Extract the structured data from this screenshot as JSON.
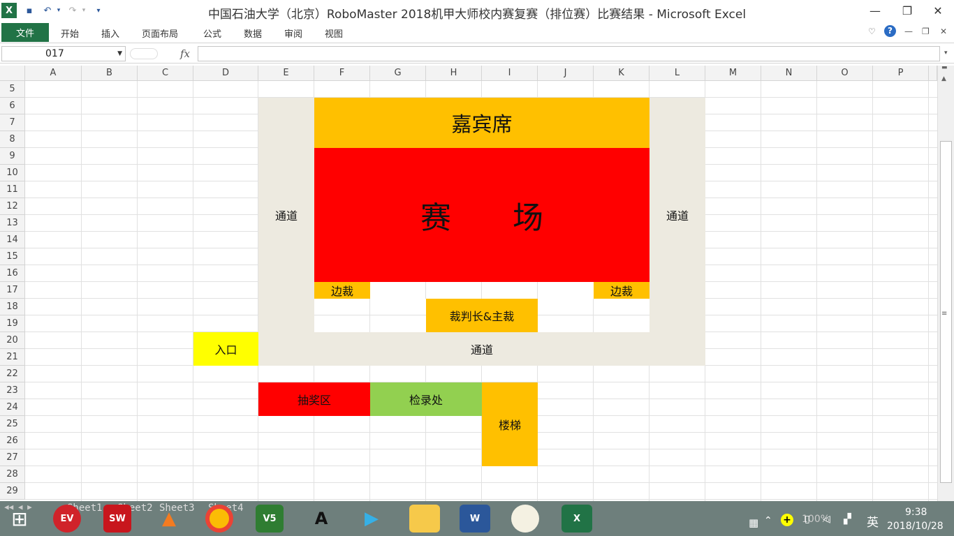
{
  "window": {
    "title": "中国石油大学（北京）RoboMaster 2018机甲大师校内赛复赛（排位赛）比赛结果 - Microsoft Excel"
  },
  "ribbon": {
    "file_tab": "文件",
    "tabs": [
      "开始",
      "插入",
      "页面布局",
      "公式",
      "数据",
      "审阅",
      "视图"
    ]
  },
  "formula_bar": {
    "name_box": "017",
    "fx_label": "fx",
    "formula": ""
  },
  "columns": [
    "A",
    "B",
    "C",
    "D",
    "E",
    "F",
    "G",
    "H",
    "I",
    "J",
    "K",
    "L",
    "M",
    "N",
    "O",
    "P"
  ],
  "rows": [
    "5",
    "6",
    "7",
    "8",
    "9",
    "10",
    "11",
    "12",
    "13",
    "14",
    "15",
    "16",
    "17",
    "18",
    "19",
    "20",
    "21",
    "22",
    "23",
    "24",
    "25",
    "26",
    "27",
    "28",
    "29"
  ],
  "layout_labels": {
    "guest_seats": "嘉宾席",
    "arena": "赛　　场",
    "aisle_left": "通道",
    "aisle_right": "通道",
    "aisle_bottom": "通道",
    "side_referee_left": "边裁",
    "side_referee_right": "边裁",
    "chief_referee": "裁判长&主裁",
    "entrance": "入口",
    "lottery_area": "抽奖区",
    "inspection": "检录处",
    "stairs": "楼梯"
  },
  "colors": {
    "aisle": "#edeae0",
    "orange": "#ffc000",
    "red": "#ff0000",
    "yellow": "#ffff00",
    "green": "#92d050",
    "excel_green": "#217346"
  },
  "sheets": [
    "Sheet1",
    "Sheet2",
    "Sheet3",
    "Sheet4"
  ],
  "status": {
    "zoom": "100%"
  },
  "tray": {
    "ime": "英",
    "time": "9:38",
    "date": "2018/10/28"
  },
  "taskbar_apps": [
    "windows-start",
    "expressvpn",
    "solidworks-2017",
    "matlab",
    "chrome",
    "vs-5",
    "autocad-2017",
    "player",
    "file-explorer",
    "word",
    "app-circle",
    "excel"
  ]
}
